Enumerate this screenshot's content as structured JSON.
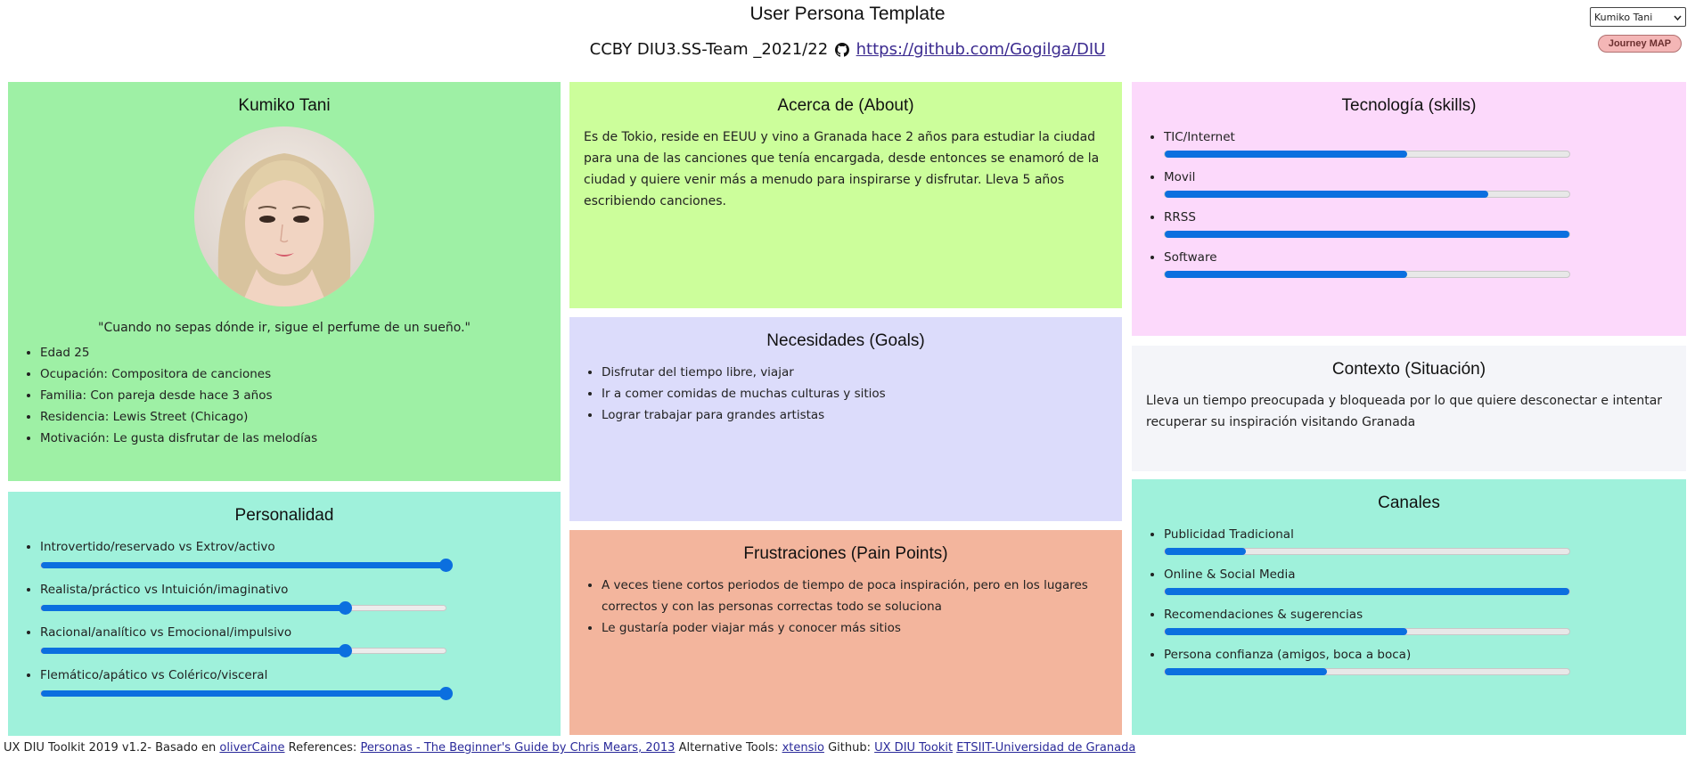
{
  "header": {
    "title": "User Persona Template",
    "subtitle_prefix": "CCBY DIU3.SS-Team _2021/22",
    "repo_link": "https://github.com/Gogilga/DIU"
  },
  "controls": {
    "persona_selected": "Kumiko Tani",
    "journey_button": "Journey MAP"
  },
  "profile": {
    "name": "Kumiko Tani",
    "quote": "\"Cuando no sepas dónde ir, sigue el perfume de un sueño.\"",
    "facts": [
      "Edad 25",
      "Ocupación: Compositora de canciones",
      "Familia: Con pareja desde hace 3 años",
      "Residencia: Lewis Street (Chicago)",
      "Motivación: Le gusta disfrutar de las melodías"
    ]
  },
  "personality": {
    "title": "Personalidad",
    "items": [
      {
        "label": "Introvertido/reservado vs Extrov/activo",
        "value": 1.0
      },
      {
        "label": "Realista/práctico vs Intuición/imaginativo",
        "value": 0.75
      },
      {
        "label": "Racional/analítico vs Emocional/impulsivo",
        "value": 0.75
      },
      {
        "label": "Flemático/apático vs Colérico/visceral",
        "value": 1.0
      }
    ]
  },
  "about": {
    "title": "Acerca de (About)",
    "text": "Es de Tokio, reside en EEUU y vino a Granada hace 2 años para estudiar la ciudad para una de las canciones que tenía encargada, desde entonces se enamoró de la ciudad y quiere venir más a menudo para inspirarse y disfrutar. Lleva 5 años escribiendo canciones."
  },
  "goals": {
    "title": "Necesidades (Goals)",
    "items": [
      "Disfrutar del tiempo libre, viajar",
      "Ir a comer comidas de muchas culturas y sitios",
      "Lograr trabajar para grandes artistas"
    ]
  },
  "pain": {
    "title": "Frustraciones (Pain Points)",
    "items": [
      "A veces tiene cortos periodos de tiempo de poca inspiración, pero en los lugares correctos y con las personas correctas todo se soluciona",
      "Le gustaría poder viajar más y conocer más sitios"
    ]
  },
  "tech": {
    "title": "Tecnología (skills)",
    "items": [
      {
        "label": "TIC/Internet",
        "value": 0.6
      },
      {
        "label": "Movil",
        "value": 0.8
      },
      {
        "label": "RRSS",
        "value": 1.0
      },
      {
        "label": "Software",
        "value": 0.6
      }
    ]
  },
  "context": {
    "title": "Contexto (Situación)",
    "text": "Lleva un tiempo preocupada y bloqueada por lo que quiere desconectar e intentar recuperar su inspiración visitando Granada"
  },
  "channels": {
    "title": "Canales",
    "items": [
      {
        "label": "Publicidad Tradicional",
        "value": 0.2
      },
      {
        "label": "Online & Social Media",
        "value": 1.0
      },
      {
        "label": "Recomendaciones & sugerencias",
        "value": 0.6
      },
      {
        "label": "Persona confianza (amigos, boca a boca)",
        "value": 0.4
      }
    ]
  },
  "footer": {
    "prefix": "UX DIU Toolkit 2019 v1.2- Basado en",
    "basado_link": "oliverCaine",
    "refs_label": "References:",
    "refs_link": "Personas - The Beginner's Guide by Chris Mears, 2013",
    "alt_label": "Alternative Tools:",
    "alt_link": "xtensio",
    "github_label": "Github:",
    "github_link": "UX DIU Tookit",
    "etsiit_link": "ETSIIT-Universidad de Granada"
  },
  "colors": {
    "accent": "#0b6fdf",
    "profile_bg": "#9ef0a5",
    "about_bg": "#ccfe9b",
    "goals_bg": "#dcdcfb",
    "pain_bg": "#f3b59d",
    "tech_bg": "#fcd9fb",
    "context_bg": "#f4f5f9",
    "channels_bg": "#9ff1db"
  }
}
